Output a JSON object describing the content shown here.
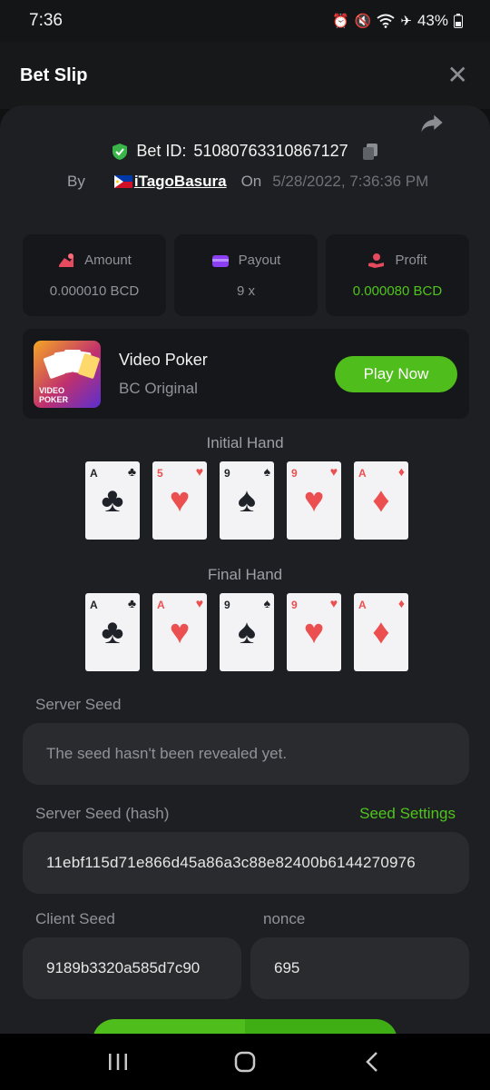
{
  "status": {
    "time": "7:36",
    "battery": "43%"
  },
  "header": {
    "title": "Bet Slip"
  },
  "bet": {
    "id_label": "Bet ID:",
    "id": "51080763310867127",
    "by_label": "By",
    "user": "iTagoBasura",
    "on_label": "On",
    "date": "5/28/2022, 7:36:36 PM"
  },
  "stats": [
    {
      "label": "Amount",
      "value": "0.000010 BCD",
      "icon": "coins-icon"
    },
    {
      "label": "Payout",
      "value": "9 x",
      "icon": "wallet-icon"
    },
    {
      "label": "Profit",
      "value": "0.000080 BCD",
      "icon": "hand-coin-icon"
    }
  ],
  "game": {
    "name": "Video Poker",
    "provider": "BC Original",
    "play_label": "Play Now",
    "thumb_text": "VIDEO POKER"
  },
  "initial_hand": {
    "title": "Initial Hand",
    "cards": [
      {
        "rank": "A",
        "suit": "♣",
        "color": "black"
      },
      {
        "rank": "5",
        "suit": "♥",
        "color": "red"
      },
      {
        "rank": "9",
        "suit": "♠",
        "color": "black"
      },
      {
        "rank": "9",
        "suit": "♥",
        "color": "red"
      },
      {
        "rank": "A",
        "suit": "♦",
        "color": "red"
      }
    ]
  },
  "final_hand": {
    "title": "Final Hand",
    "cards": [
      {
        "rank": "A",
        "suit": "♣",
        "color": "black"
      },
      {
        "rank": "A",
        "suit": "♥",
        "color": "red"
      },
      {
        "rank": "9",
        "suit": "♠",
        "color": "black"
      },
      {
        "rank": "9",
        "suit": "♥",
        "color": "red"
      },
      {
        "rank": "A",
        "suit": "♦",
        "color": "red"
      }
    ]
  },
  "seeds": {
    "server_label": "Server Seed",
    "server_value": "The seed hasn't been revealed yet.",
    "hash_label": "Server Seed (hash)",
    "settings_label": "Seed Settings",
    "hash_value": "11ebf115d71e866d45a86a3c88e82400b6144270976",
    "client_label": "Client Seed",
    "client_value": "9189b3320a585d7c90",
    "nonce_label": "nonce",
    "nonce_value": "695"
  },
  "colors": {
    "accent": "#4fbd1c",
    "profit": "#4fc41c",
    "panel": "#1e1f22",
    "tile": "#16171a"
  }
}
